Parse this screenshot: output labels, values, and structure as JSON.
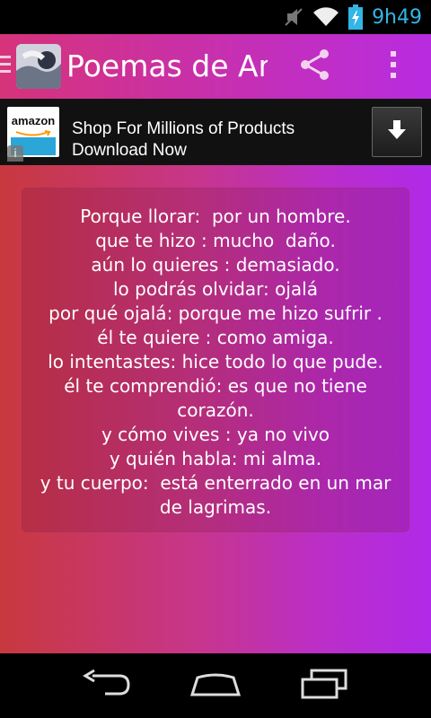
{
  "status_bar": {
    "time": "9h49",
    "icons": [
      "mute-icon",
      "wifi-icon",
      "battery-charging-icon"
    ]
  },
  "action_bar": {
    "title": "Poemas de Ami",
    "icons": [
      "drawer-icon",
      "app-icon",
      "share-icon",
      "overflow-menu-icon"
    ]
  },
  "ad": {
    "logo_text": "amazon",
    "text": "Shop For Millions of Products Download Now",
    "info_label": "i",
    "icon": "download-icon"
  },
  "poem": {
    "lines": [
      "Porque llorar:  por un hombre.",
      "que te hizo : mucho  daño.",
      "aún lo quieres : demasiado.",
      "lo podrás olvidar: ojalá",
      "por qué ojalá: porque me hizo sufrir .",
      "él te quiere : como amiga.",
      "lo intentastes: hice todo lo que pude.",
      "él te comprendió: es que no tiene",
      "corazón.",
      "y cómo vives : ya no vivo",
      "y quién habla: mi alma.",
      "y tu cuerpo:  está enterrado en un mar",
      "de lagrimas."
    ]
  },
  "nav_bar": {
    "icons": [
      "back-icon",
      "home-icon",
      "recents-icon"
    ]
  },
  "colors": {
    "status_accent": "#33b5e5",
    "action_bar_start": "#d6337a",
    "action_bar_end": "#b82ce0",
    "main_start": "#c8383e",
    "main_end": "#b02ae8"
  }
}
